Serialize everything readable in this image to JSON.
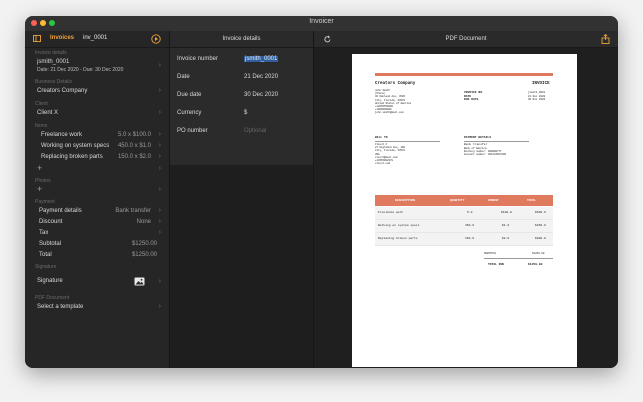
{
  "window": {
    "title": "Invoicer"
  },
  "sidebar": {
    "invoices_label": "Invoices",
    "invoice_id": "inv_0001",
    "sections": {
      "invoice_details": "Invoice details",
      "business_details": "Business Details",
      "client": "Client",
      "items": "Items",
      "photos": "Photos",
      "payment": "Payment",
      "signature": "Signature",
      "pdf_document": "PDF Document"
    },
    "invoice_title": "jsmith_0001",
    "invoice_dates": "Date: 21 Dec 2020 - Due: 30 Dec 2020",
    "business_name": "Creators Company",
    "client_name": "Client X",
    "items": [
      {
        "name": "Freelance work",
        "value": "5.0 x $100.0"
      },
      {
        "name": "Working on system specs",
        "value": "450.0 x $1.0"
      },
      {
        "name": "Replacing broken parts",
        "value": "150.0 x $2.0"
      }
    ],
    "add_symbol": "+",
    "payment": [
      {
        "name": "Payment details",
        "value": "Bank transfer"
      },
      {
        "name": "Discount",
        "value": "None"
      },
      {
        "name": "Tax",
        "value": ""
      },
      {
        "name": "Subtotal",
        "value": "$1250.00"
      },
      {
        "name": "Total",
        "value": "$1250.00"
      }
    ],
    "signature_label": "Signature",
    "select_template": "Select a template"
  },
  "middle": {
    "header": "Invoice details",
    "fields": [
      {
        "label": "Invoice number",
        "value": "jsmith_0001"
      },
      {
        "label": "Date",
        "value": "21 Dec 2020"
      },
      {
        "label": "Due date",
        "value": "30 Dec 2020"
      },
      {
        "label": "Currency",
        "value": "$"
      },
      {
        "label": "PO number",
        "placeholder": "Optional"
      }
    ]
  },
  "right": {
    "header": "PDF Document"
  },
  "pdf": {
    "company": "Creators Company",
    "heading": "INVOICE",
    "from_address": "John Smith\n(Phone)\n46 Oakland Ave, 4506\nCity, Florida, 33078\nUnited States of America\n+12065550000\n+1000000000\njohn.smith@mail.com",
    "meta_labels": "INVOICE NO.\nDATE\nDUE DATE",
    "meta_values": "jsmith_0001\n21 Dec 2020\n30 Dec 2020",
    "bill_to_label": "BILL TO",
    "bill_to": "Client X\n27 Highland Ave, 490\nCity, Florida, 33578\nUSA\nclient@mail.com\n+13665002378\nclient.com",
    "payment_label": "PAYMENT DETAILS",
    "payment_method": "Bank transfer",
    "payment_info": "Bank of America\nRouting number: 000000777\nAccount number: 991234567890",
    "table_headers": [
      "DESCRIPTION",
      "QUANTITY",
      "AMOUNT",
      "TOTAL"
    ],
    "rows": [
      [
        "Freelance work",
        "5.0",
        "$100.0",
        "$500.0"
      ],
      [
        "Working on system specs",
        "450.0",
        "$1.0",
        "$450.0"
      ],
      [
        "Replacing broken parts",
        "150.0",
        "$2.0",
        "$300.0"
      ]
    ],
    "subtotal_label": "SUBTOTAL",
    "subtotal_value": "$1250.00",
    "total_label": "TOTAL DUE",
    "total_value": "$1250.00"
  },
  "colors": {
    "accent": "#f0a23a",
    "pdf_accent": "#e07a5f",
    "selection": "#2f5f9f"
  },
  "icons": [
    "close-icon",
    "minimize-icon",
    "zoom-icon",
    "sidebar-toggle-icon",
    "play-icon",
    "refresh-icon",
    "share-icon",
    "chevron-right-icon",
    "image-icon"
  ]
}
